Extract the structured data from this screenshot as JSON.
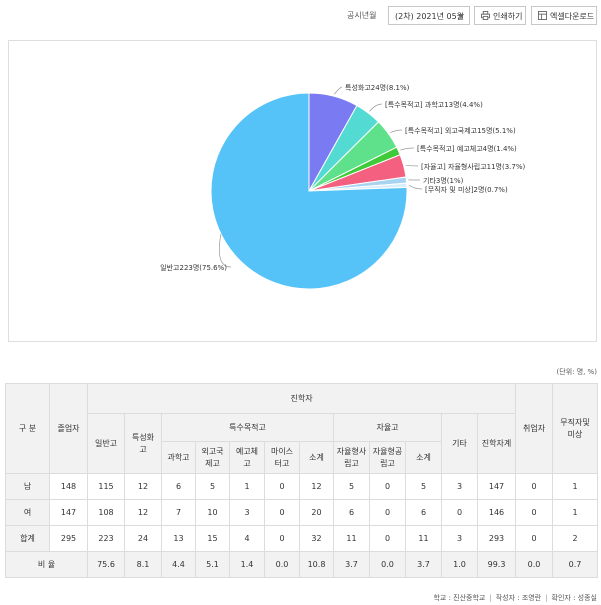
{
  "toolbar": {
    "label": "공시년월",
    "select_value": "(2차) 2021년 05월",
    "print_label": "인쇄하기",
    "excel_label": "엑셀다운로드"
  },
  "chart_data": {
    "type": "pie",
    "slices": [
      {
        "label": "일반고223명(75.6%)",
        "value": 223,
        "percent": 75.6,
        "color": "#55c3f7"
      },
      {
        "label": "특성화고24명(8.1%)",
        "value": 24,
        "percent": 8.1,
        "color": "#7a7bf2"
      },
      {
        "label": "[특수목적고] 과학고13명(4.4%)",
        "value": 13,
        "percent": 4.4,
        "color": "#53dbd3"
      },
      {
        "label": "[특수목적고] 외고국제고15명(5.1%)",
        "value": 15,
        "percent": 5.1,
        "color": "#5fe08a"
      },
      {
        "label": "[특수목적고] 예고체고4명(1.4%)",
        "value": 4,
        "percent": 1.4,
        "color": "#3fca3a"
      },
      {
        "label": "[자율고] 자율형사립고11명(3.7%)",
        "value": 11,
        "percent": 3.7,
        "color": "#f4607f"
      },
      {
        "label": "기타3명(1%)",
        "value": 3,
        "percent": 1.0,
        "color": "#a9d4f0"
      },
      {
        "label": "[무직자 및 미상]2명(0.7%)",
        "value": 2,
        "percent": 0.7,
        "color": "#d9eefc"
      }
    ]
  },
  "unit": "(단위: 명, %)",
  "table": {
    "h_gubun": "구 분",
    "h_graduates": "졸업자",
    "h_advance": "진학자",
    "h_general": "일반고",
    "h_special": "특성화고",
    "h_purpose": "특수목적고",
    "h_autonomous": "자율고",
    "h_other": "기타",
    "h_advance_total": "진학자계",
    "h_employed": "취업자",
    "h_unemployed": "무직자및 미상",
    "h_science": "과학고",
    "h_foreign": "외고국제고",
    "h_arts": "예고체고",
    "h_meister": "마이스터고",
    "h_subtotal1": "소계",
    "h_private": "자율형사립고",
    "h_public": "자율형공립고",
    "h_subtotal2": "소계",
    "rows": [
      {
        "label": "남",
        "cells": [
          "148",
          "115",
          "12",
          "6",
          "5",
          "1",
          "0",
          "12",
          "5",
          "0",
          "5",
          "3",
          "147",
          "0",
          "1"
        ]
      },
      {
        "label": "여",
        "cells": [
          "147",
          "108",
          "12",
          "7",
          "10",
          "3",
          "0",
          "20",
          "6",
          "0",
          "6",
          "0",
          "146",
          "0",
          "1"
        ]
      },
      {
        "label": "합계",
        "cells": [
          "295",
          "223",
          "24",
          "13",
          "15",
          "4",
          "0",
          "32",
          "11",
          "0",
          "11",
          "3",
          "293",
          "0",
          "2"
        ]
      },
      {
        "label": "비 율",
        "cells": [
          "",
          "75.6",
          "8.1",
          "4.4",
          "5.1",
          "1.4",
          "0.0",
          "10.8",
          "3.7",
          "0.0",
          "3.7",
          "1.0",
          "99.3",
          "0.0",
          "0.7"
        ]
      }
    ]
  },
  "footer": {
    "school": "학교 : 진산중학교",
    "writer": "작성자 : 조영란",
    "checker": "확인자 : 성종실",
    "sep": "|"
  }
}
